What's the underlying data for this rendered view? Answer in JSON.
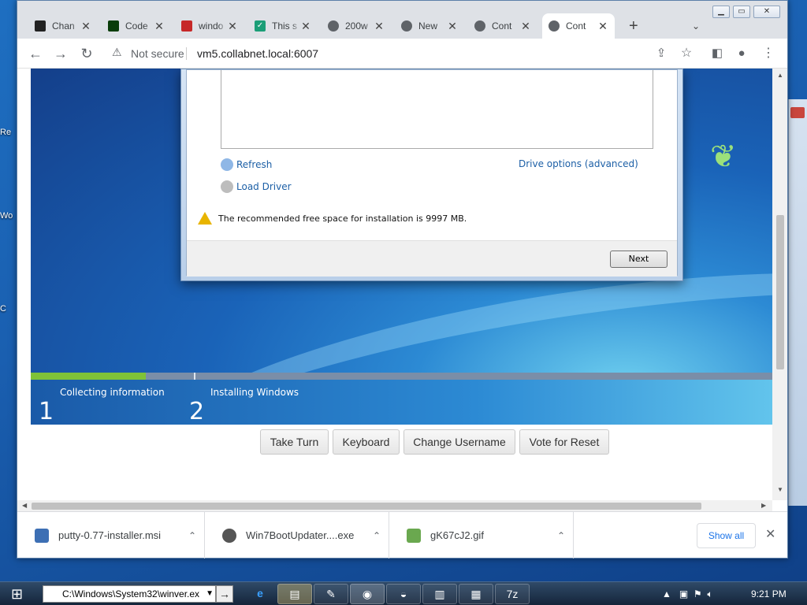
{
  "desktop": {
    "icon_labels": [
      "Re",
      "Wo",
      "C"
    ]
  },
  "browser": {
    "tabs": [
      {
        "title": "Chan",
        "icon": "terminal-icon",
        "color": "#222222"
      },
      {
        "title": "Code",
        "icon": "matrix-icon",
        "color": "#0a3d0a"
      },
      {
        "title": "windo",
        "icon": "doc-icon",
        "color": "#c62828"
      },
      {
        "title": "This s",
        "icon": "check-icon",
        "color": "#1b9e77"
      },
      {
        "title": "200w",
        "icon": "globe-icon",
        "color": "#5f6368"
      },
      {
        "title": "New",
        "icon": "chrome-icon",
        "color": "#5f6368"
      },
      {
        "title": "Cont",
        "icon": "globe-icon",
        "color": "#5f6368"
      },
      {
        "title": "Cont",
        "icon": "globe-icon",
        "color": "#5f6368",
        "active": true
      }
    ],
    "new_tab": "+",
    "security_label": "Not secure",
    "url": "vm5.collabnet.local:6007"
  },
  "installer": {
    "refresh_label": "Refresh",
    "drive_options_label": "Drive options (advanced)",
    "load_driver_label": "Load Driver",
    "warning_text": "The recommended free space for installation is 9997 MB.",
    "next_label": "Next",
    "steps": [
      {
        "num": "1",
        "label": "Collecting information"
      },
      {
        "num": "2",
        "label": "Installing Windows"
      }
    ],
    "progress_fraction": 0.155
  },
  "vm_controls": {
    "take_turn": "Take Turn",
    "keyboard": "Keyboard",
    "change_username": "Change Username",
    "vote_reset": "Vote for Reset"
  },
  "downloads": {
    "items": [
      {
        "name": "putty-0.77-installer.msi",
        "icon": "msi-icon",
        "color": "#3d6fb4"
      },
      {
        "name": "Win7BootUpdater....exe",
        "icon": "exe-icon",
        "color": "#555555"
      },
      {
        "name": "gK67cJ2.gif",
        "icon": "gif-icon",
        "color": "#6aa84f"
      }
    ],
    "show_all": "Show all"
  },
  "taskbar": {
    "run_path": "C:\\Windows\\System32\\winver.ex",
    "clock": "9:21 PM"
  }
}
